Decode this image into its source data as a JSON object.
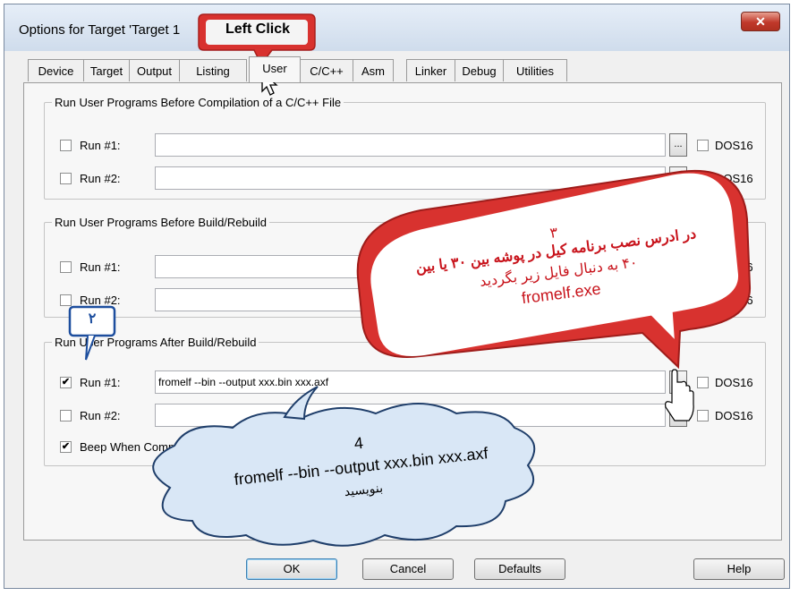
{
  "window": {
    "title": "Options for Target 'Target 1",
    "close_glyph": "✕"
  },
  "tabs": [
    {
      "label": "Device"
    },
    {
      "label": "Target"
    },
    {
      "label": "Output"
    },
    {
      "label": "Listing"
    },
    {
      "label": "User",
      "active": true
    },
    {
      "label": "C/C++"
    },
    {
      "label": "Asm"
    },
    {
      "label": "Linker"
    },
    {
      "label": "Debug"
    },
    {
      "label": "Utilities"
    }
  ],
  "groups": {
    "before_compile": {
      "legend": "Run User Programs Before Compilation of a C/C++ File",
      "run1": {
        "label": "Run #1:",
        "checked": false,
        "value": "",
        "dos_label": "DOS16"
      },
      "run2": {
        "label": "Run #2:",
        "checked": false,
        "value": "",
        "dos_label": "DOS16"
      }
    },
    "before_build": {
      "legend": "Run User Programs Before Build/Rebuild",
      "run1": {
        "label": "Run #1:",
        "checked": false,
        "value": "",
        "dos_label": "DOS16"
      },
      "run2": {
        "label": "Run #2:",
        "checked": false,
        "value": "",
        "dos_label": "DOS16"
      }
    },
    "after_build": {
      "legend": "Run User Programs After Build/Rebuild",
      "run1": {
        "label": "Run #1:",
        "checked": true,
        "value": "fromelf --bin --output xxx.bin xxx.axf",
        "dos_label": "DOS16"
      },
      "run2": {
        "label": "Run #2:",
        "checked": false,
        "value": "",
        "dos_label": "DOS16"
      },
      "beep": {
        "label": "Beep When Complete",
        "checked": true
      }
    }
  },
  "browse_label": "...",
  "check_mark": "✔",
  "buttons": {
    "ok": "OK",
    "cancel": "Cancel",
    "defaults": "Defaults",
    "help": "Help"
  },
  "annotations": {
    "left_click": "Left Click",
    "step2_number": "۲",
    "step3_number": "۳",
    "step3_line1": "در ادرس نصب برنامه کیل در پوشه بین ۳۰ یا بین",
    "step3_line2": "۴۰ به دنبال فایل زیر بگردید",
    "step3_file": "fromelf.exe",
    "step4_number": "4",
    "step4_command": "fromelf --bin --output xxx.bin xxx.axf",
    "step4_word": "بنویسید",
    "colors": {
      "red_callout": "#d8322f",
      "red_text": "#c8141c",
      "blue_outline": "#1d4e9e",
      "cloud_fill": "#d9e7f6"
    }
  }
}
